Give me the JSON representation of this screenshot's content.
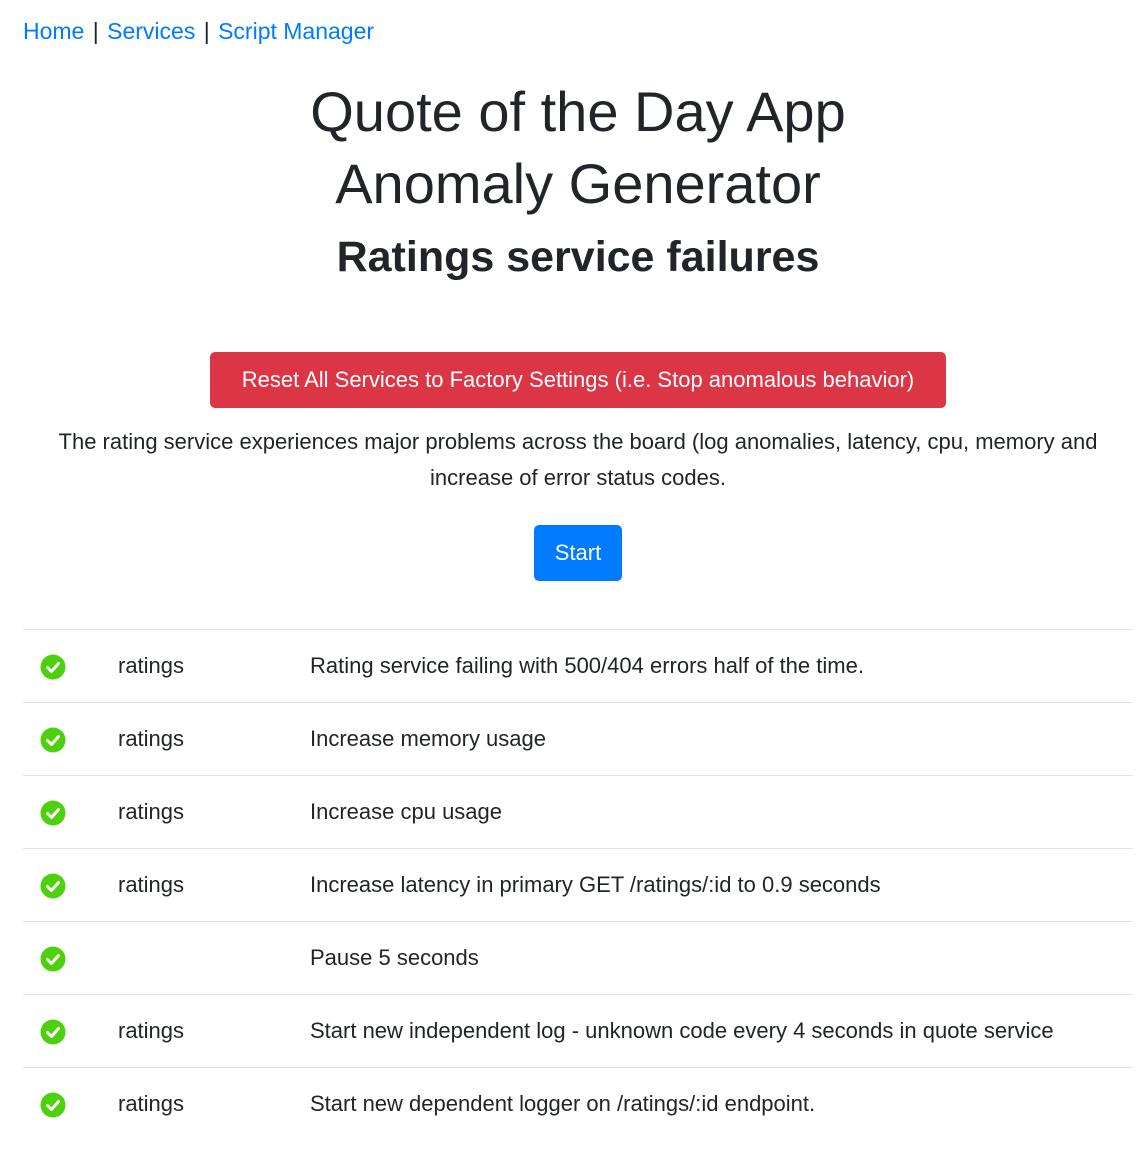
{
  "nav": {
    "home": "Home",
    "services": "Services",
    "script_manager": "Script Manager",
    "separator": "|"
  },
  "header": {
    "title_line1": "Quote of the Day App",
    "title_line2": "Anomaly Generator",
    "subtitle": "Ratings service failures"
  },
  "actions": {
    "reset_label": "Reset All Services to Factory Settings (i.e. Stop anomalous behavior)",
    "start_label": "Start"
  },
  "description": "The rating service experiences major problems across the board (log anomalies, latency, cpu, memory and increase of error status codes.",
  "colors": {
    "link": "#007bff",
    "danger": "#dc3545",
    "primary": "#007bff",
    "success": "#4cd10c"
  },
  "steps": [
    {
      "status_icon": "check-circle-icon",
      "service": "ratings",
      "description": "Rating service failing with 500/404 errors half of the time."
    },
    {
      "status_icon": "check-circle-icon",
      "service": "ratings",
      "description": "Increase memory usage"
    },
    {
      "status_icon": "check-circle-icon",
      "service": "ratings",
      "description": "Increase cpu usage"
    },
    {
      "status_icon": "check-circle-icon",
      "service": "ratings",
      "description": "Increase latency in primary GET /ratings/:id to 0.9 seconds"
    },
    {
      "status_icon": "check-circle-icon",
      "service": "",
      "description": "Pause 5 seconds"
    },
    {
      "status_icon": "check-circle-icon",
      "service": "ratings",
      "description": "Start new independent log - unknown code every 4 seconds in quote service"
    },
    {
      "status_icon": "check-circle-icon",
      "service": "ratings",
      "description": "Start new dependent logger on /ratings/:id endpoint."
    }
  ]
}
